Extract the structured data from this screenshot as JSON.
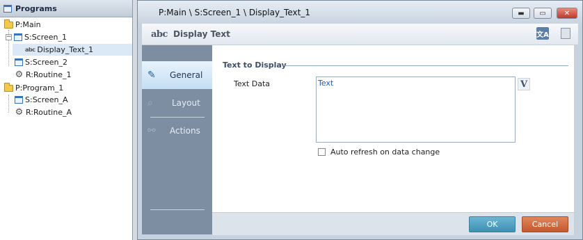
{
  "tree": {
    "header": "Programs",
    "items": [
      {
        "label": "P:Main",
        "icon": "folder-icon"
      },
      {
        "label": "S:Screen_1",
        "icon": "screen-icon"
      },
      {
        "label": "Display_Text_1",
        "icon": "text-object-icon",
        "icon_text": "abc"
      },
      {
        "label": "S:Screen_2",
        "icon": "screen-icon"
      },
      {
        "label": "R:Routine_1",
        "icon": "gear-icon"
      },
      {
        "label": "P:Program_1",
        "icon": "folder-icon"
      },
      {
        "label": "S:Screen_A",
        "icon": "screen-icon"
      },
      {
        "label": "R:Routine_A",
        "icon": "gear-icon"
      }
    ]
  },
  "window": {
    "title": "P:Main \\ S:Screen_1 \\ Display_Text_1",
    "controls": {
      "minimize": "▬",
      "maximize": "▭",
      "close": "✕"
    }
  },
  "header": {
    "logo_text": "abc",
    "title": "Display Text",
    "translate_icon_text": "文A"
  },
  "nav": {
    "items": [
      {
        "label": "General",
        "icon": "general-icon"
      },
      {
        "label": "Layout",
        "icon": "layout-icon"
      },
      {
        "label": "Actions",
        "icon": "actions-icon"
      }
    ],
    "active": "General"
  },
  "form": {
    "section_title": "Text to Display",
    "text_data_label": "Text Data",
    "text_data_value": "Text",
    "variable_button": "V",
    "auto_refresh_label": "Auto refresh on data change",
    "auto_refresh_checked": false
  },
  "footer": {
    "ok_label": "OK",
    "cancel_label": "Cancel"
  },
  "colors": {
    "ok": "#4fa3c5",
    "cancel": "#d46a3e",
    "nav_bg": "#7d8ea3"
  }
}
